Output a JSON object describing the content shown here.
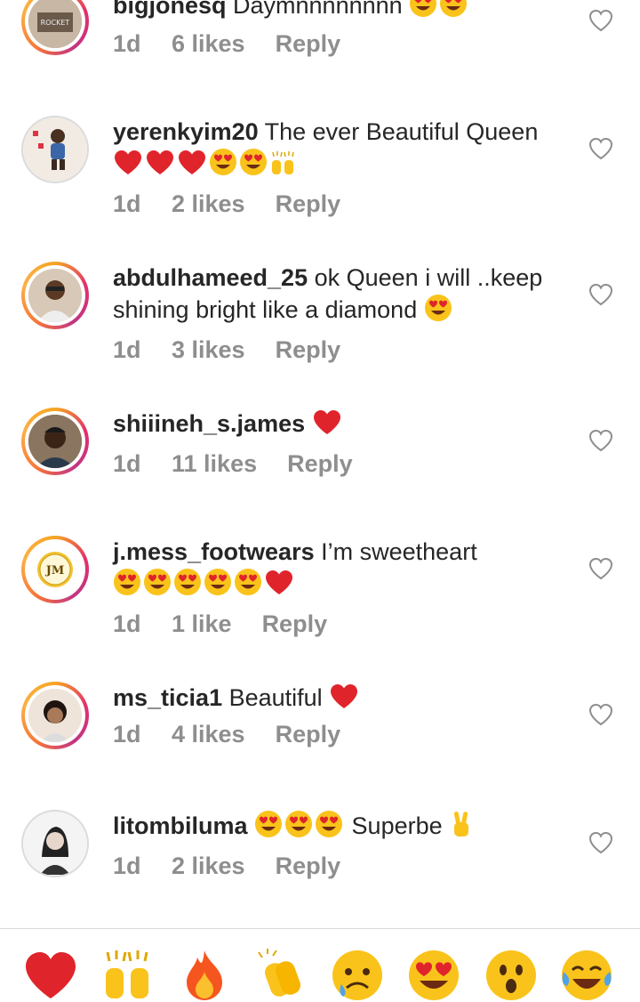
{
  "comments": [
    {
      "username": "bigjonesq",
      "text": "Daymnnnnnnnn",
      "emojis": [
        "heart-eyes-emoji",
        "heart-eyes-emoji"
      ],
      "time": "1d",
      "likes": "6 likes",
      "reply": "Reply",
      "avatar": "avatar-photo",
      "ring": true
    },
    {
      "username": "yerenkyim20",
      "text": "The ever Beautiful Queen",
      "emojis": [
        "red-heart-emoji",
        "red-heart-emoji",
        "red-heart-emoji",
        "heart-eyes-emoji",
        "heart-eyes-emoji",
        "raising-hands-emoji"
      ],
      "time": "1d",
      "likes": "2 likes",
      "reply": "Reply",
      "avatar": "avatar-photo",
      "ring": false
    },
    {
      "username": "abdulhameed_25",
      "text": "ok Queen i will ..keep shining bright like a diamond",
      "emojis": [
        "heart-eyes-emoji"
      ],
      "time": "1d",
      "likes": "3 likes",
      "reply": "Reply",
      "avatar": "avatar-photo",
      "ring": true
    },
    {
      "username": "shiiineh_s.james",
      "text": "",
      "emojis": [
        "red-heart-emoji"
      ],
      "time": "1d",
      "likes": "11 likes",
      "reply": "Reply",
      "avatar": "avatar-photo",
      "ring": true
    },
    {
      "username": "j.mess_footwears",
      "text": "I’m sweetheart",
      "emojis": [
        "heart-eyes-emoji",
        "heart-eyes-emoji",
        "heart-eyes-emoji",
        "heart-eyes-emoji",
        "heart-eyes-emoji",
        "red-heart-emoji"
      ],
      "time": "1d",
      "likes": "1 like",
      "reply": "Reply",
      "avatar": "avatar-logo",
      "ring": true
    },
    {
      "username": "ms_ticia1",
      "text": "Beautiful",
      "emojis": [
        "red-heart-emoji"
      ],
      "time": "1d",
      "likes": "4 likes",
      "reply": "Reply",
      "avatar": "avatar-photo",
      "ring": true
    },
    {
      "username": "litombiluma",
      "text": "",
      "emojis": [
        "heart-eyes-emoji",
        "heart-eyes-emoji",
        "heart-eyes-emoji"
      ],
      "text_after": "Superbe",
      "emojis_after": [
        "victory-hand-emoji"
      ],
      "time": "1d",
      "likes": "2 likes",
      "reply": "Reply",
      "avatar": "avatar-photo",
      "ring": false
    }
  ],
  "reaction_bar": [
    "red-heart-emoji",
    "raising-hands-emoji",
    "fire-emoji",
    "clapping-hands-emoji",
    "sad-relieved-emoji",
    "heart-eyes-emoji",
    "surprised-emoji",
    "tears-of-joy-emoji"
  ],
  "colors": {
    "meta_gray": "#8e8e8e",
    "text": "#262626",
    "heart": "#e0242b",
    "emoji_yellow": "#f9c31b"
  }
}
